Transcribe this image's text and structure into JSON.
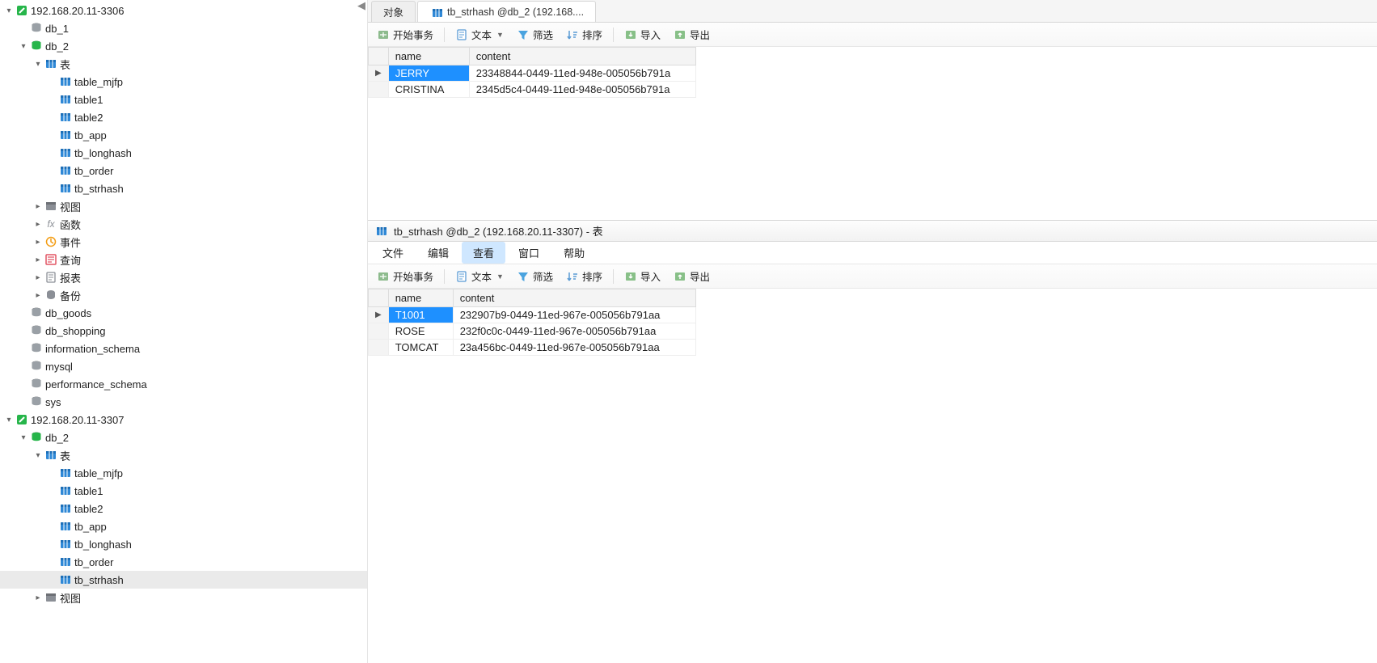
{
  "sidebar": {
    "conn1": {
      "label": "192.168.20.11-3306"
    },
    "conn1_dbs": {
      "db1": "db_1",
      "db2": "db_2",
      "goods": "db_goods",
      "shopping": "db_shopping",
      "infoschema": "information_schema",
      "mysql": "mysql",
      "perf": "performance_schema",
      "sys": "sys"
    },
    "db2_children": {
      "tables_label": "表",
      "tables": {
        "t0": "table_mjfp",
        "t1": "table1",
        "t2": "table2",
        "t3": "tb_app",
        "t4": "tb_longhash",
        "t5": "tb_order",
        "t6": "tb_strhash"
      },
      "views": "视图",
      "functions": "函数",
      "events": "事件",
      "queries": "查询",
      "reports": "报表",
      "backup": "备份"
    },
    "conn2": {
      "label": "192.168.20.11-3307"
    },
    "conn2_db2": "db_2",
    "conn2_tables_label": "表",
    "conn2_tables": {
      "t0": "table_mjfp",
      "t1": "table1",
      "t2": "table2",
      "t3": "tb_app",
      "t4": "tb_longhash",
      "t5": "tb_order",
      "t6": "tb_strhash"
    },
    "conn2_views": "视图"
  },
  "topPane": {
    "tabs": {
      "objects": "对象",
      "active": "tb_strhash @db_2 (192.168...."
    },
    "toolbar": {
      "beginTx": "开始事务",
      "text": "文本",
      "filter": "筛选",
      "sort": "排序",
      "import": "导入",
      "export": "导出"
    },
    "columns": {
      "c0": "name",
      "c1": "content"
    },
    "rows": [
      {
        "c0": "JERRY",
        "c1": "23348844-0449-11ed-948e-005056b791a"
      },
      {
        "c0": "CRISTINA",
        "c1": "2345d5c4-0449-11ed-948e-005056b791a"
      }
    ],
    "cur_row": 0
  },
  "bottomPane": {
    "title": "tb_strhash @db_2 (192.168.20.11-3307) - 表",
    "menu": {
      "file": "文件",
      "edit": "编辑",
      "view": "查看",
      "window": "窗口",
      "help": "帮助"
    },
    "toolbar": {
      "beginTx": "开始事务",
      "text": "文本",
      "filter": "筛选",
      "sort": "排序",
      "import": "导入",
      "export": "导出"
    },
    "columns": {
      "c0": "name",
      "c1": "content"
    },
    "rows": [
      {
        "c0": "T1001",
        "c1": "232907b9-0449-11ed-967e-005056b791aa"
      },
      {
        "c0": "ROSE",
        "c1": "232f0c0c-0449-11ed-967e-005056b791aa"
      },
      {
        "c0": "TOMCAT",
        "c1": "23a456bc-0449-11ed-967e-005056b791aa"
      }
    ],
    "cur_row": 0
  }
}
